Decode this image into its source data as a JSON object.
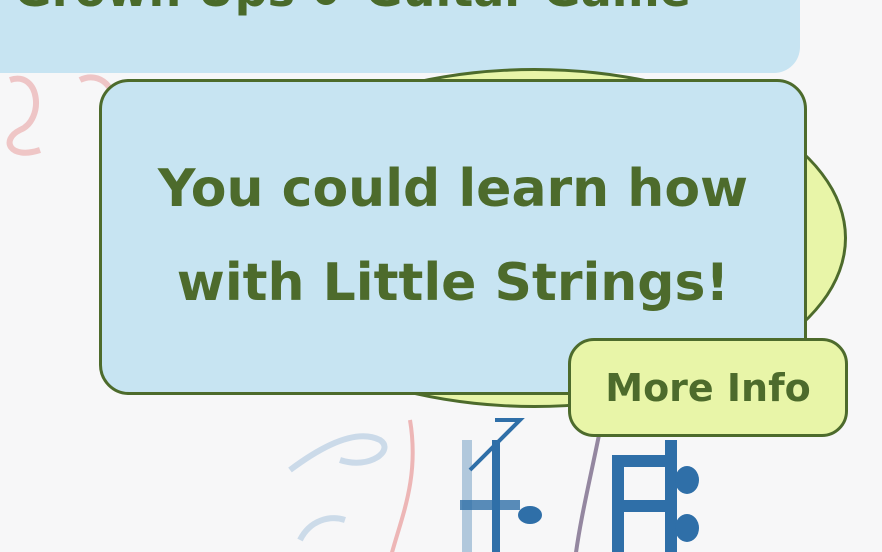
{
  "header": {
    "title_left": "Grown Ups",
    "title_icon": "guitar-icon",
    "title_right": "Guitar Game"
  },
  "promo": {
    "line1": "You could learn how",
    "line2": "with Little Strings!",
    "button_label": "More Info"
  },
  "colors": {
    "page_bg": "#f7f7f8",
    "card_blue": "#c7e4f2",
    "lime": "#e8f5a8",
    "dark_green": "#4d6b2c"
  }
}
